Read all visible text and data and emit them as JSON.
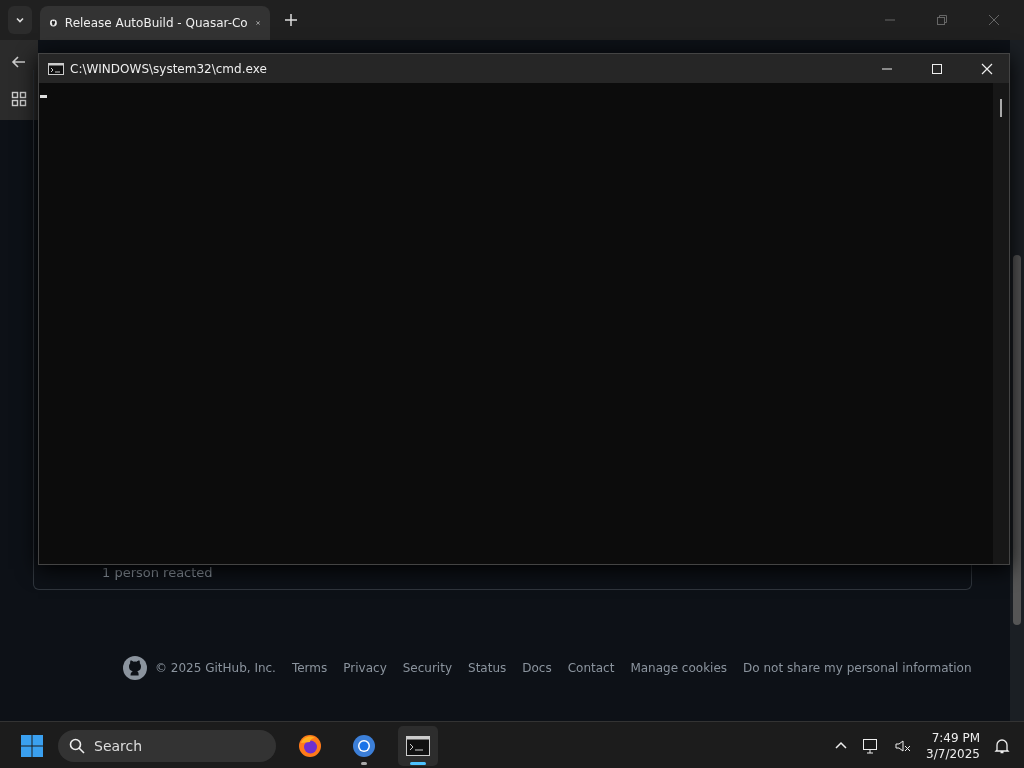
{
  "browser": {
    "tabs": [
      {
        "title": "Release AutoBuild - Quasar-Co",
        "selected": true
      }
    ]
  },
  "page": {
    "reactions": "1 person reacted",
    "footer": {
      "copyright": "© 2025 GitHub, Inc.",
      "links": [
        "Terms",
        "Privacy",
        "Security",
        "Status",
        "Docs",
        "Contact",
        "Manage cookies",
        "Do not share my personal information"
      ]
    }
  },
  "console_window": {
    "title": "C:\\WINDOWS\\system32\\cmd.exe"
  },
  "taskbar": {
    "search": {
      "placeholder": "Search"
    },
    "apps": [
      {
        "kind": "firefox",
        "running": false,
        "active": false
      },
      {
        "kind": "chrome",
        "running": true,
        "active": false
      },
      {
        "kind": "terminal",
        "running": true,
        "active": true
      }
    ],
    "clock": {
      "time": "7:49 PM",
      "date": "3/7/2025"
    }
  }
}
